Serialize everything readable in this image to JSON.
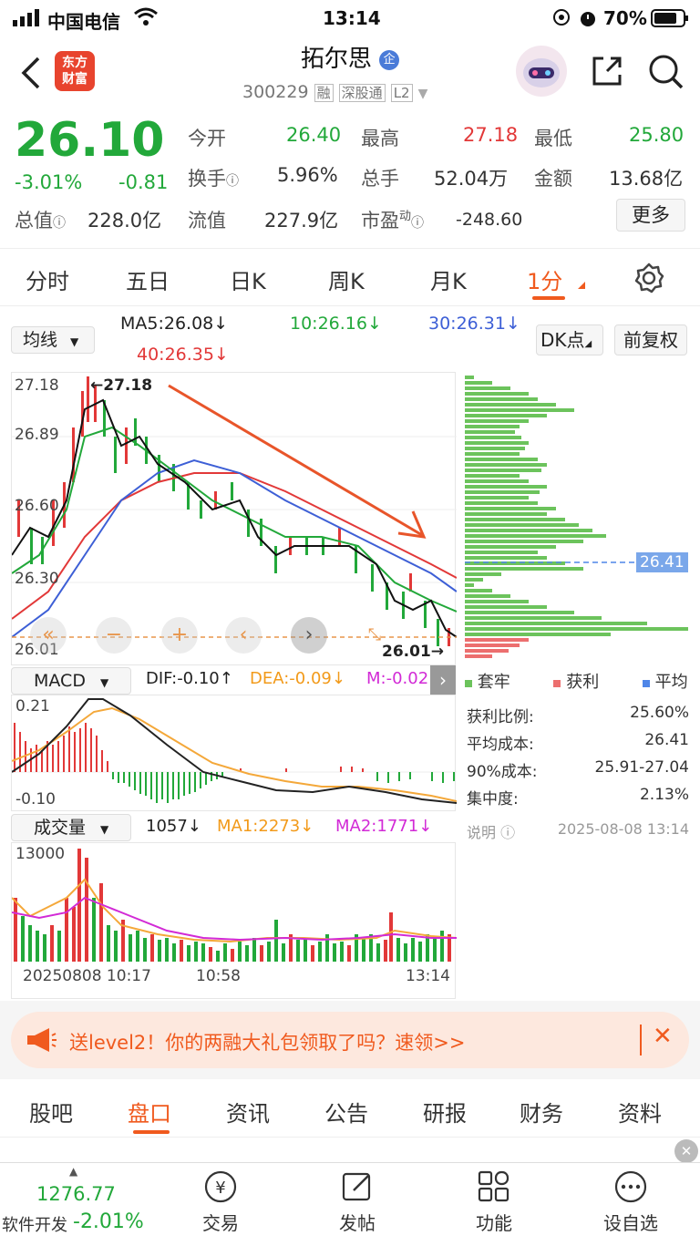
{
  "statusbar": {
    "carrier": "中国电信",
    "time": "13:14",
    "battery": "70%"
  },
  "header": {
    "stock_name": "拓尔思",
    "badge": "企",
    "code": "300229",
    "tags": [
      "融",
      "深股通",
      "L2"
    ],
    "logo_text": [
      "东方",
      "财富"
    ]
  },
  "quote": {
    "price": "26.10",
    "change_pct": "-3.01%",
    "change": "-0.81",
    "total_value_label": "总值",
    "total_value": "228.0亿",
    "open_label": "今开",
    "open": "26.40",
    "high_label": "最高",
    "high": "27.18",
    "low_label": "最低",
    "low": "25.80",
    "turnover_label": "换手",
    "turnover": "5.96%",
    "volume_label": "总手",
    "volume": "52.04万",
    "amount_label": "金额",
    "amount": "13.68亿",
    "float_label": "流值",
    "float_value": "227.9亿",
    "pe_label": "市盈",
    "pe_sup": "动",
    "pe": "-248.60",
    "more_label": "更多"
  },
  "tabs": [
    "分时",
    "五日",
    "日K",
    "周K",
    "月K",
    "1分"
  ],
  "active_tab": "1分",
  "chart_toolbar": {
    "ma_select": "均线",
    "ma5": "MA5:26.08↓",
    "ma10": "10:26.16↓",
    "ma30": "30:26.31↓",
    "ma40": "40:26.35↓",
    "dk_button": "DK点",
    "adjust_button": "前复权"
  },
  "price_chart": {
    "axis_labels": [
      "27.18",
      "26.89",
      "26.60",
      "26.30",
      "26.01"
    ],
    "high_marker": "27.18",
    "low_marker": "26.01",
    "cost_line_label": "26.41"
  },
  "macd": {
    "select": "MACD",
    "dif": "DIF:-0.10↑",
    "dea": "DEA:-0.09↓",
    "m": "M:-0.02",
    "axis_top": "0.21",
    "axis_bottom": "-0.10"
  },
  "volume": {
    "select": "成交量",
    "current": "1057↓",
    "ma1": "MA1:2273↓",
    "ma2": "MA2:1771↓",
    "axis_top": "13000",
    "time_labels": [
      "20250808 10:17",
      "10:58",
      "13:14"
    ]
  },
  "chip_panel": {
    "legend": [
      "套牢",
      "获利",
      "平均"
    ],
    "stats": [
      {
        "label": "获利比例:",
        "value": "25.60%"
      },
      {
        "label": "平均成本:",
        "value": "26.41"
      },
      {
        "label": "90%成本:",
        "value": "25.91-27.04"
      },
      {
        "label": "集中度:",
        "value": "2.13%"
      }
    ],
    "note_label": "说明",
    "timestamp": "2025-08-08 13:14"
  },
  "banner": {
    "text": "送level2！你的两融大礼包领取了吗？速领>>"
  },
  "bottom_tabs": [
    "股吧",
    "盘口",
    "资讯",
    "公告",
    "研报",
    "财务",
    "资料"
  ],
  "active_bottom_tab": "盘口",
  "bottom_nav": {
    "index_value": "1276.77",
    "index_name": "软件开发",
    "index_change": "-2.01%",
    "items": [
      "交易",
      "发帖",
      "功能",
      "设自选"
    ]
  }
}
